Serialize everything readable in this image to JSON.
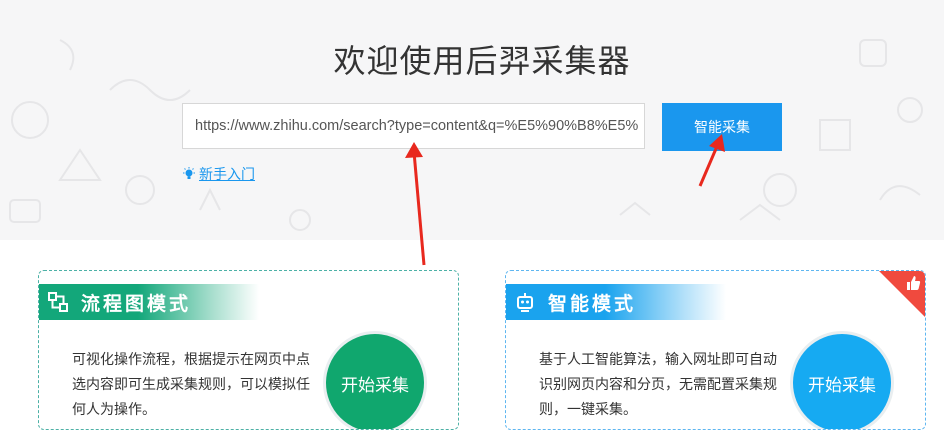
{
  "header": {
    "title": "欢迎使用后羿采集器"
  },
  "search": {
    "url_value": "https://www.zhihu.com/search?type=content&q=%E5%90%B8%E5%",
    "button_label": "智能采集"
  },
  "guide": {
    "link_label": "新手入门"
  },
  "cards": [
    {
      "title": "流程图模式",
      "description": "可视化操作流程，根据提示在网页中点选内容即可生成采集规则，可以模拟任何人为操作。",
      "button_label": "开始采集",
      "icon": "flowchart-icon",
      "color": "#13a77a"
    },
    {
      "title": "智能模式",
      "description": "基于人工智能算法，输入网址即可自动识别网页内容和分页，无需配置采集规则，一键采集。",
      "button_label": "开始采集",
      "icon": "robot-icon",
      "color": "#1aa3ee",
      "badge_icon": "thumbs-up-icon",
      "badge_color": "#f04a3e"
    }
  ]
}
